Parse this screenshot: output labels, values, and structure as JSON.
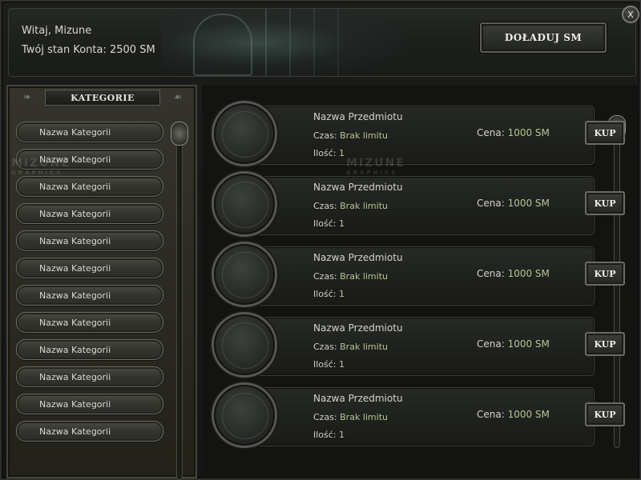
{
  "header": {
    "greeting_prefix": "Witaj, ",
    "username": "Mizune",
    "balance_label": "Twój stan Konta: ",
    "balance_value": "2500 SM",
    "topup_label": "DOŁADUJ SM",
    "close_label": "X"
  },
  "categories": {
    "title": "KATEGORIE",
    "items": [
      "Nazwa Kategorii",
      "Nazwa Kategorii",
      "Nazwa Kategorii",
      "Nazwa Kategorii",
      "Nazwa Kategorii",
      "Nazwa Kategorii",
      "Nazwa Kategorii",
      "Nazwa Kategorii",
      "Nazwa Kategorii",
      "Nazwa Kategorii",
      "Nazwa Kategorii",
      "Nazwa Kategorii"
    ]
  },
  "items": [
    {
      "name": "Nazwa Przedmiotu",
      "time_label": "Czas: ",
      "time_value": "Brak limitu",
      "qty_label": "Ilość: ",
      "qty_value": "1",
      "price_label": "Cena: ",
      "price_value": "1000 SM",
      "buy_label": "KUP"
    },
    {
      "name": "Nazwa Przedmiotu",
      "time_label": "Czas: ",
      "time_value": "Brak limitu",
      "qty_label": "Ilość: ",
      "qty_value": "1",
      "price_label": "Cena: ",
      "price_value": "1000 SM",
      "buy_label": "KUP"
    },
    {
      "name": "Nazwa Przedmiotu",
      "time_label": "Czas: ",
      "time_value": "Brak limitu",
      "qty_label": "Ilość: ",
      "qty_value": "1",
      "price_label": "Cena: ",
      "price_value": "1000 SM",
      "buy_label": "KUP"
    },
    {
      "name": "Nazwa Przedmiotu",
      "time_label": "Czas: ",
      "time_value": "Brak limitu",
      "qty_label": "Ilość: ",
      "qty_value": "1",
      "price_label": "Cena: ",
      "price_value": "1000 SM",
      "buy_label": "KUP"
    },
    {
      "name": "Nazwa Przedmiotu",
      "time_label": "Czas: ",
      "time_value": "Brak limitu",
      "qty_label": "Ilość: ",
      "qty_value": "1",
      "price_label": "Cena: ",
      "price_value": "1000 SM",
      "buy_label": "KUP"
    }
  ],
  "watermark": {
    "main": "MIZUNE",
    "sub": "GRAPHICS"
  },
  "colors": {
    "value_accent": "#b9c48f",
    "text": "#d2d3cd",
    "frame": "#6a6c62"
  }
}
